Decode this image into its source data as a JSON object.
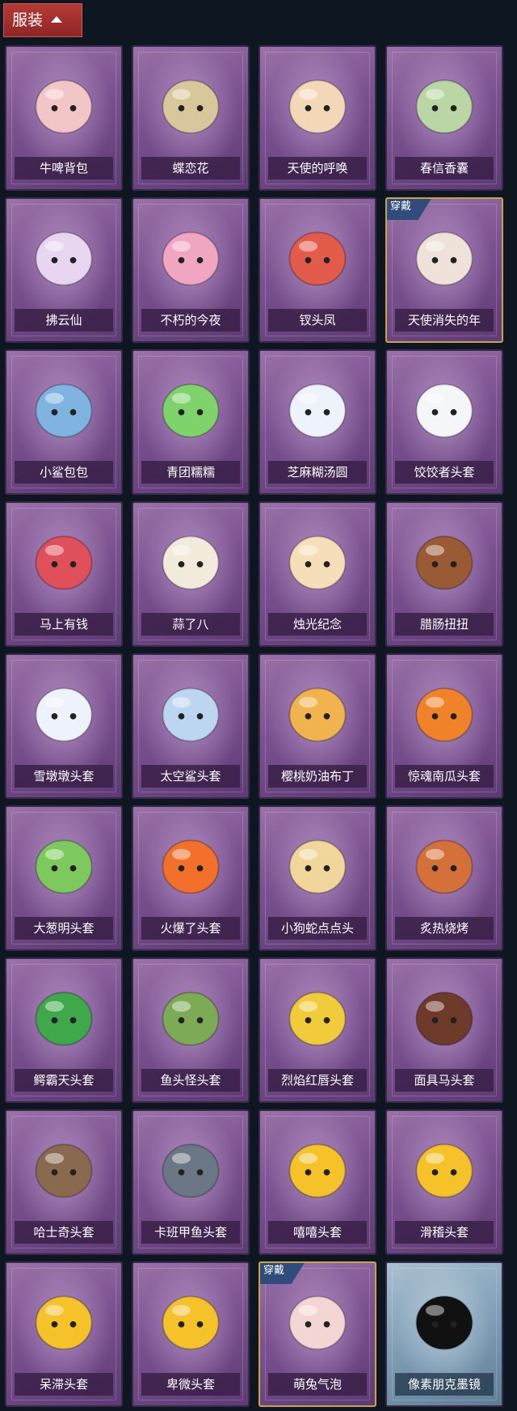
{
  "header": {
    "label": "服装"
  },
  "worn_badge": "穿戴",
  "items": [
    {
      "label": "牛啤背包",
      "icon": "cow-beer-barrel-backpack-icon",
      "color": "#f2c6c6",
      "worn": false
    },
    {
      "label": "蝶恋花",
      "icon": "butterfly-bell-wreath-icon",
      "color": "#d8c79a",
      "worn": false
    },
    {
      "label": "天使的呼唤",
      "icon": "angel-doll-icon",
      "color": "#f3d8b8",
      "worn": false
    },
    {
      "label": "春信香囊",
      "icon": "green-sachet-icon",
      "color": "#b9d6a4",
      "worn": false
    },
    {
      "label": "拂云仙",
      "icon": "cloud-fairy-ornament-icon",
      "color": "#e8d6f0",
      "worn": false
    },
    {
      "label": "不朽的今夜",
      "icon": "pink-fox-cup-icon",
      "color": "#f0a5c0",
      "worn": false
    },
    {
      "label": "钗头凤",
      "icon": "phoenix-crown-doll-icon",
      "color": "#e25b4b",
      "worn": false
    },
    {
      "label": "天使消失的年",
      "icon": "veiled-angel-doll-icon",
      "color": "#efe3d9",
      "worn": true
    },
    {
      "label": "小鲨包包",
      "icon": "blue-shark-bag-icon",
      "color": "#7fb3e0",
      "worn": false
    },
    {
      "label": "青团糯糯",
      "icon": "green-rice-ball-icon",
      "color": "#7ed46a",
      "worn": false
    },
    {
      "label": "芝麻糊汤圆",
      "icon": "white-dumpling-icon",
      "color": "#eef2fb",
      "worn": false
    },
    {
      "label": "饺饺者头套",
      "icon": "cloud-dumpling-head-icon",
      "color": "#f4f6f8",
      "worn": false
    },
    {
      "label": "马上有钱",
      "icon": "red-horse-head-icon",
      "color": "#e0505a",
      "worn": false
    },
    {
      "label": "蒜了八",
      "icon": "garlic-head-icon",
      "color": "#f2eadb",
      "worn": false
    },
    {
      "label": "烛光纪念",
      "icon": "candle-head-icon",
      "color": "#f6dfb8",
      "worn": false
    },
    {
      "label": "腊肠扭扭",
      "icon": "dachshund-head-icon",
      "color": "#9a5a34",
      "worn": false
    },
    {
      "label": "雪墩墩头套",
      "icon": "snowman-reindeer-head-icon",
      "color": "#eef2fa",
      "worn": false
    },
    {
      "label": "太空鲨头套",
      "icon": "space-shark-head-icon",
      "color": "#bcd6f2",
      "worn": false
    },
    {
      "label": "樱桃奶油布丁",
      "icon": "pudding-head-icon",
      "color": "#f0b34e",
      "worn": false
    },
    {
      "label": "惊魂南瓜头套",
      "icon": "pumpkin-head-icon",
      "color": "#f0832a",
      "worn": false
    },
    {
      "label": "大葱明头套",
      "icon": "scallion-head-icon",
      "color": "#7ec95e",
      "worn": false
    },
    {
      "label": "火爆了头套",
      "icon": "fire-head-icon",
      "color": "#f2702a",
      "worn": false
    },
    {
      "label": "小狗蛇点点头",
      "icon": "dog-snake-head-icon",
      "color": "#f0d69a",
      "worn": false
    },
    {
      "label": "炙热烧烤",
      "icon": "bbq-meat-head-icon",
      "color": "#d4713a",
      "worn": false
    },
    {
      "label": "鳄霸天头套",
      "icon": "crocodile-head-icon",
      "color": "#3ea84a",
      "worn": false
    },
    {
      "label": "鱼头怪头套",
      "icon": "fish-monster-head-icon",
      "color": "#7caa55",
      "worn": false
    },
    {
      "label": "烈焰红唇头套",
      "icon": "yellow-hood-sunglasses-head-icon",
      "color": "#f0cb3a",
      "worn": false
    },
    {
      "label": "面具马头套",
      "icon": "horse-mask-head-icon",
      "color": "#6e3a2a",
      "worn": false
    },
    {
      "label": "哈士奇头套",
      "icon": "husky-sunglasses-head-icon",
      "color": "#8a6a4e",
      "worn": false
    },
    {
      "label": "卡班甲鱼头套",
      "icon": "dark-fish-head-icon",
      "color": "#6b7785",
      "worn": false
    },
    {
      "label": "嘻嘻头套",
      "icon": "grinning-emoji-head-icon",
      "color": "#f5c22a",
      "worn": false
    },
    {
      "label": "滑稽头套",
      "icon": "smirk-emoji-head-icon",
      "color": "#f5c22a",
      "worn": false
    },
    {
      "label": "呆滞头套",
      "icon": "dazed-emoji-head-icon",
      "color": "#f5c22a",
      "worn": false
    },
    {
      "label": "卑微头套",
      "icon": "timid-emoji-head-icon",
      "color": "#f5c22a",
      "worn": false
    },
    {
      "label": "萌兔气泡",
      "icon": "bunny-bubble-head-icon",
      "color": "#f3d6d4",
      "worn": true
    },
    {
      "label": "像素朋克墨镜",
      "icon": "pixel-sunglasses-icon",
      "color": "#111111",
      "worn": false
    }
  ]
}
